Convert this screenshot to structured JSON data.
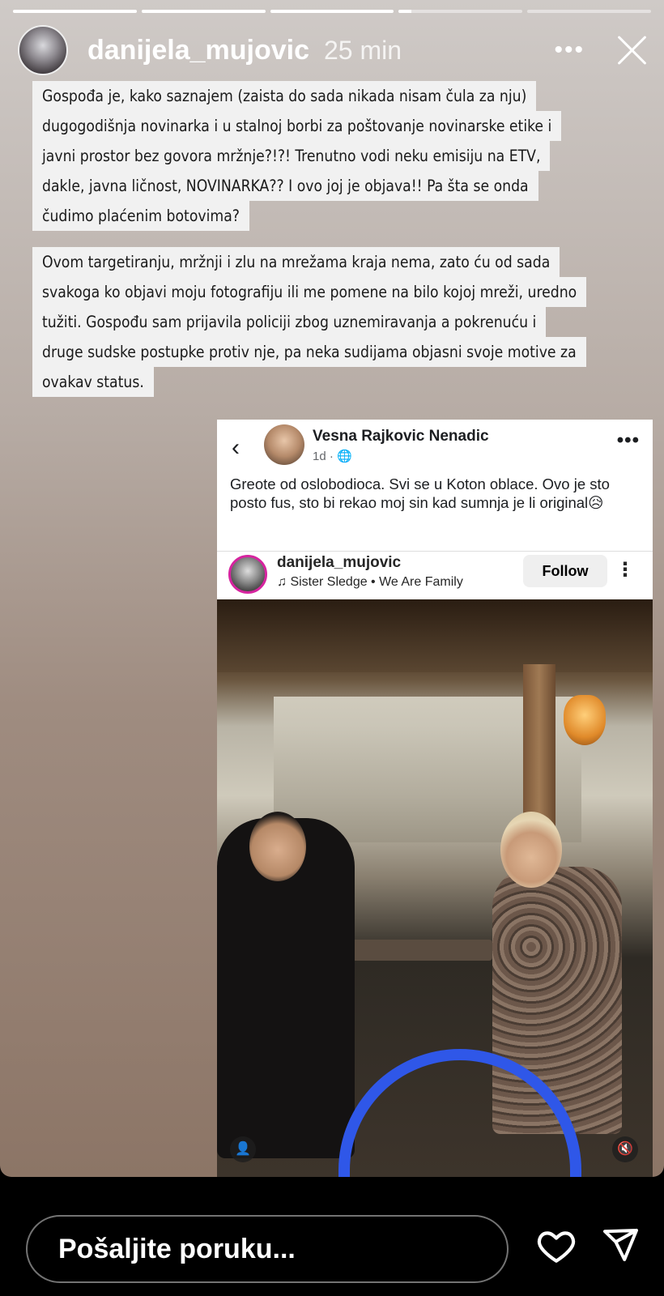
{
  "story": {
    "progress": [
      1,
      1,
      1,
      0.1,
      0,
      0
    ],
    "header": {
      "username": "danijela_mujovic",
      "time": "25 min",
      "more_label": "•••"
    },
    "text_paragraphs": [
      [
        "Gospođa je, kako saznajem (zaista do sada nikada nisam čula za nju)",
        "dugogodišnja novinarka i u stalnoj borbi za poštovanje novinarske etike i",
        "javni prostor bez govora mržnje?!?! Trenutno vodi neku emisiju na ETV,",
        "dakle, javna ličnost, NOVINARKA?? I ovo joj je objava!! Pa šta se onda",
        "čudimo plaćenim botovima?"
      ],
      [
        "Ovom targetiranju, mržnji i zlu na mrežama kraja nema, zato ću od sada",
        "svakoga ko objavi moju fotografiju ili me pomene na bilo kojoj mreži, uredno",
        "tužiti. Gospođu sam prijavila policiji zbog uznemiravanja a pokrenuću i",
        "druge sudske postupke protiv nje, pa neka sudijama objasni svoje motive za",
        "ovakav status."
      ]
    ],
    "fb_post": {
      "back_icon": "‹",
      "author": "Vesna Rajkovic Nenadic",
      "meta": "1d · 🌐",
      "more_label": "•••",
      "text": "Greote od oslobodioca. Svi se u Koton oblace. Ovo je sto posto fus, sto bi rekao moj sin kad sumnja je li original😥",
      "embed": {
        "username": "danijela_mujovic",
        "music": "♫ Sister Sledge • We Are Family",
        "follow_label": "Follow",
        "more_label": "⋮"
      },
      "badges": {
        "user": "👤",
        "mute": "🔇"
      }
    }
  },
  "reply": {
    "placeholder": "Pošaljite poruku..."
  }
}
